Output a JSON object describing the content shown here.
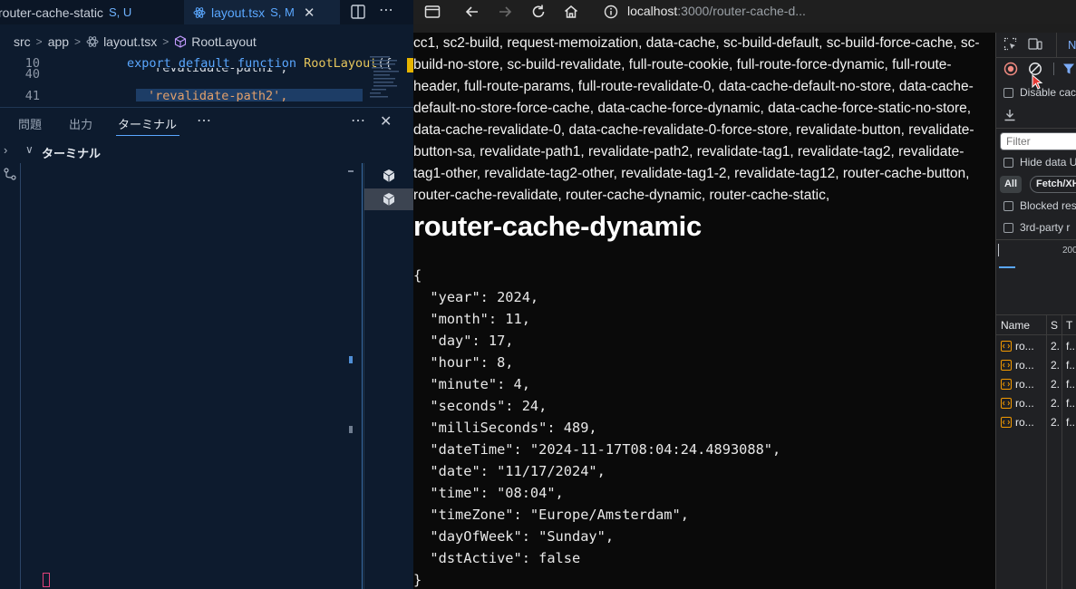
{
  "editor": {
    "tabs": [
      {
        "label": "router-cache-static",
        "status": "S, U"
      },
      {
        "label": "layout.tsx",
        "status": "S, M",
        "close": "✕"
      }
    ],
    "tab_more": "⋯",
    "breadcrumb": [
      "src",
      "app",
      "layout.tsx",
      "RootLayout"
    ],
    "lines": [
      {
        "number": "10",
        "kw1": "export default function ",
        "fn": "RootLayout",
        "rest": "({"
      },
      {
        "number": "40",
        "str": "'revalidate-path1',"
      },
      {
        "number": "41",
        "str": "'revalidate-path2',"
      }
    ],
    "panel_tabs": [
      "問題",
      "出力",
      "ターミナル"
    ],
    "panel_more": "⋯",
    "panel_close": "✕",
    "terminal_title": "ターミナル",
    "accent": "#5aa7ff"
  },
  "browser": {
    "url_host": "localhost",
    "url_path": ":3000/router-cache-d...",
    "links_text": "cc1, sc2-build, request-memoization, data-cache, sc-build-default, sc-build-force-cache, sc-build-no-store, sc-build-revalidate, full-route-cookie, full-route-force-dynamic, full-route-header, full-route-params, full-route-revalidate-0, data-cache-default-no-store, data-cache-default-no-store-force-cache, data-cache-force-dynamic, data-cache-force-static-no-store, data-cache-revalidate-0, data-cache-revalidate-0-force-store, revalidate-button, revalidate-button-sa, revalidate-path1, revalidate-path2, revalidate-tag1, revalidate-tag2, revalidate-tag1-other, revalidate-tag2-other, revalidate-tag1-2, revalidate-tag12, router-cache-button, router-cache-revalidate, router-cache-dynamic, router-cache-static,",
    "heading": "router-cache-dynamic",
    "json_lines": [
      "{",
      "  \"year\": 2024,",
      "  \"month\": 11,",
      "  \"day\": 17,",
      "  \"hour\": 8,",
      "  \"minute\": 4,",
      "  \"seconds\": 24,",
      "  \"milliSeconds\": 489,",
      "  \"dateTime\": \"2024-11-17T08:04:24.4893088\",",
      "  \"date\": \"11/17/2024\",",
      "  \"time\": \"08:04\",",
      "  \"timeZone\": \"Europe/Amsterdam\",",
      "  \"dayOfWeek\": \"Sunday\",",
      "  \"dstActive\": false",
      "}"
    ]
  },
  "devtools": {
    "tab_label": "N",
    "disable_cache": "Disable cac",
    "filter_placeholder": "Filter",
    "hide_data": "Hide data U",
    "all": "All",
    "fetch": "Fetch/XH",
    "blocked": "Blocked res",
    "third_party": "3rd-party r",
    "timeline_label": "200",
    "columns": [
      "Name",
      "S",
      "T"
    ],
    "rows": [
      {
        "name": "ro...",
        "status": "2.",
        "type": "f..."
      },
      {
        "name": "ro...",
        "status": "2.",
        "type": "f..."
      },
      {
        "name": "ro...",
        "status": "2.",
        "type": "f..."
      },
      {
        "name": "ro...",
        "status": "2.",
        "type": "f..."
      },
      {
        "name": "ro...",
        "status": "2.",
        "type": "f..."
      }
    ]
  }
}
